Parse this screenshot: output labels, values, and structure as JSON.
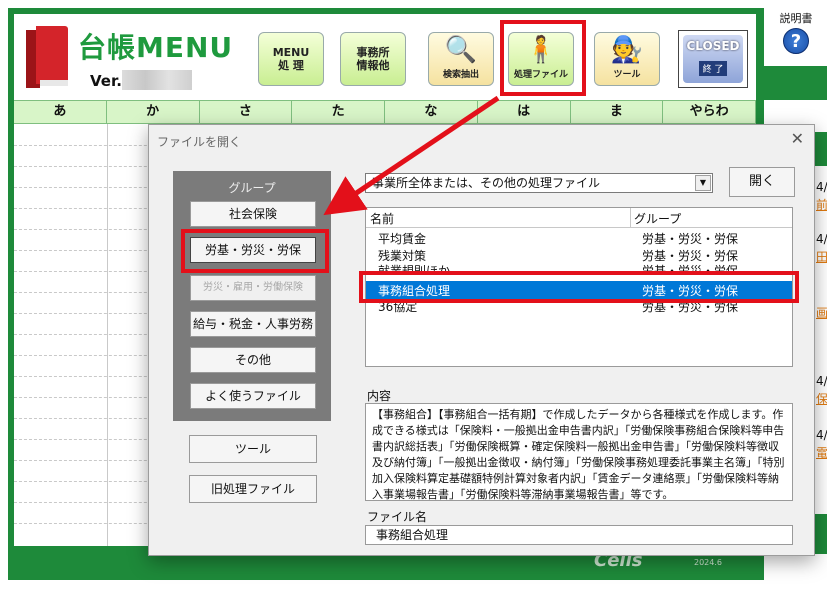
{
  "app": {
    "title": "台帳MENU",
    "version_label": "Ver.",
    "footer_logo": "Cells",
    "footer_year": "2024.6"
  },
  "toolbar": {
    "menu_label": "MENU\n処 理",
    "office_label": "事務所\n情報他",
    "search_label": "検索抽出",
    "process_file_label": "処理ファイル",
    "tool_label": "ツール",
    "closed_label": "CLOSED",
    "exit_label": "終 了"
  },
  "kana_tabs": [
    "あ",
    "か",
    "さ",
    "た",
    "な",
    "は",
    "ま",
    "やらわ"
  ],
  "help": {
    "label": "説明書",
    "icon": "?"
  },
  "right_side": {
    "texts": [
      "4/",
      "4/",
      "4/",
      "4/"
    ],
    "links": [
      "前",
      "田",
      "画",
      "保",
      "電"
    ]
  },
  "dialog": {
    "title": "ファイルを開く",
    "close": "✕",
    "group_header": "グループ",
    "group_buttons": [
      {
        "label": "社会保険"
      },
      {
        "label": "労基・労災・労保"
      },
      {
        "label": "労災・雇用・労働保険"
      },
      {
        "label": "給与・税金・人事労務"
      },
      {
        "label": "その他"
      },
      {
        "label": "よく使うファイル"
      }
    ],
    "tool_button": "ツール",
    "old_file_button": "旧処理ファイル",
    "file_type_select": "事業所全体または、その他の処理ファイル",
    "open_button": "開く",
    "list_headers": {
      "name": "名前",
      "group": "グループ"
    },
    "list_rows": [
      {
        "name": "平均賃金",
        "group": "労基・労災・労保"
      },
      {
        "name": "残業対策",
        "group": "労基・労災・労保"
      },
      {
        "name": "就業規則ほか",
        "group": "労基・労災・労保"
      },
      {
        "name": "事務組合処理",
        "group": "労基・労災・労保"
      },
      {
        "name": "36協定",
        "group": "労基・労災・労保"
      }
    ],
    "content_label": "内容",
    "content_text": "【事務組合】【事務組合一括有期】で作成したデータから各種様式を作成します。作成できる様式は「保険料・一般拠出金申告書内訳」「労働保険事務組合保険料等申告書内訳総括表」「労働保険概算・確定保険料一般拠出金申告書」「労働保険料等徴収及び納付簿」「一般拠出金徴収・納付簿」「労働保険事務処理委託事業主名簿」「特別加入保険料算定基礎額特例計算対象者内訳」「賃金データ連絡票」「労働保険料等納入事業場報告書」「労働保険料等滞納事業場報告書」等です。",
    "filename_label": "ファイル名",
    "filename_value": "事務組合処理"
  },
  "colors": {
    "frame_green": "#1e8a3a",
    "highlight_red": "#e3101a",
    "selection_blue": "#0078d7"
  }
}
